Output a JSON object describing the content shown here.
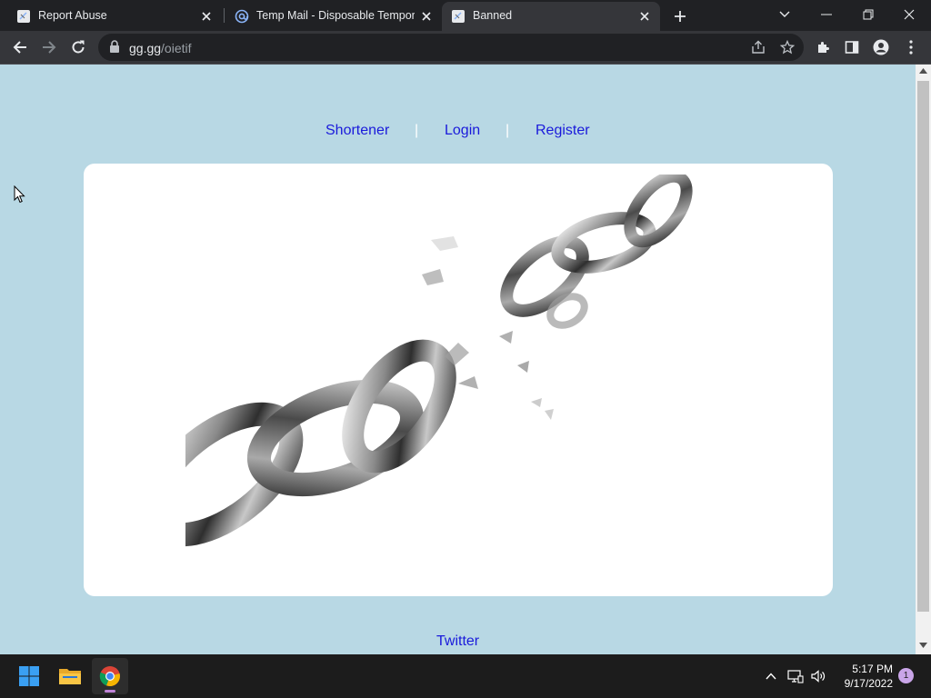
{
  "browser": {
    "tabs": [
      {
        "title": "Report Abuse",
        "favicon": "page-icon"
      },
      {
        "title": "Temp Mail - Disposable Tempora",
        "favicon": "at-sign-icon"
      },
      {
        "title": "Banned",
        "favicon": "page-icon"
      }
    ],
    "active_tab": 2,
    "url_host": "gg.gg",
    "url_path": "/oietif"
  },
  "page": {
    "nav": {
      "shortener": "Shortener",
      "separator": "|",
      "login": "Login",
      "register": "Register"
    },
    "image_subject": "broken-chain-image",
    "footer_link": "Twitter",
    "background_color": "#b8d8e4",
    "link_color": "#1a1adb"
  },
  "taskbar": {
    "time": "5:17 PM",
    "date": "9/17/2022",
    "notification_count": "1",
    "apps": [
      "windows-start-icon",
      "file-explorer-icon",
      "chrome-icon"
    ]
  }
}
